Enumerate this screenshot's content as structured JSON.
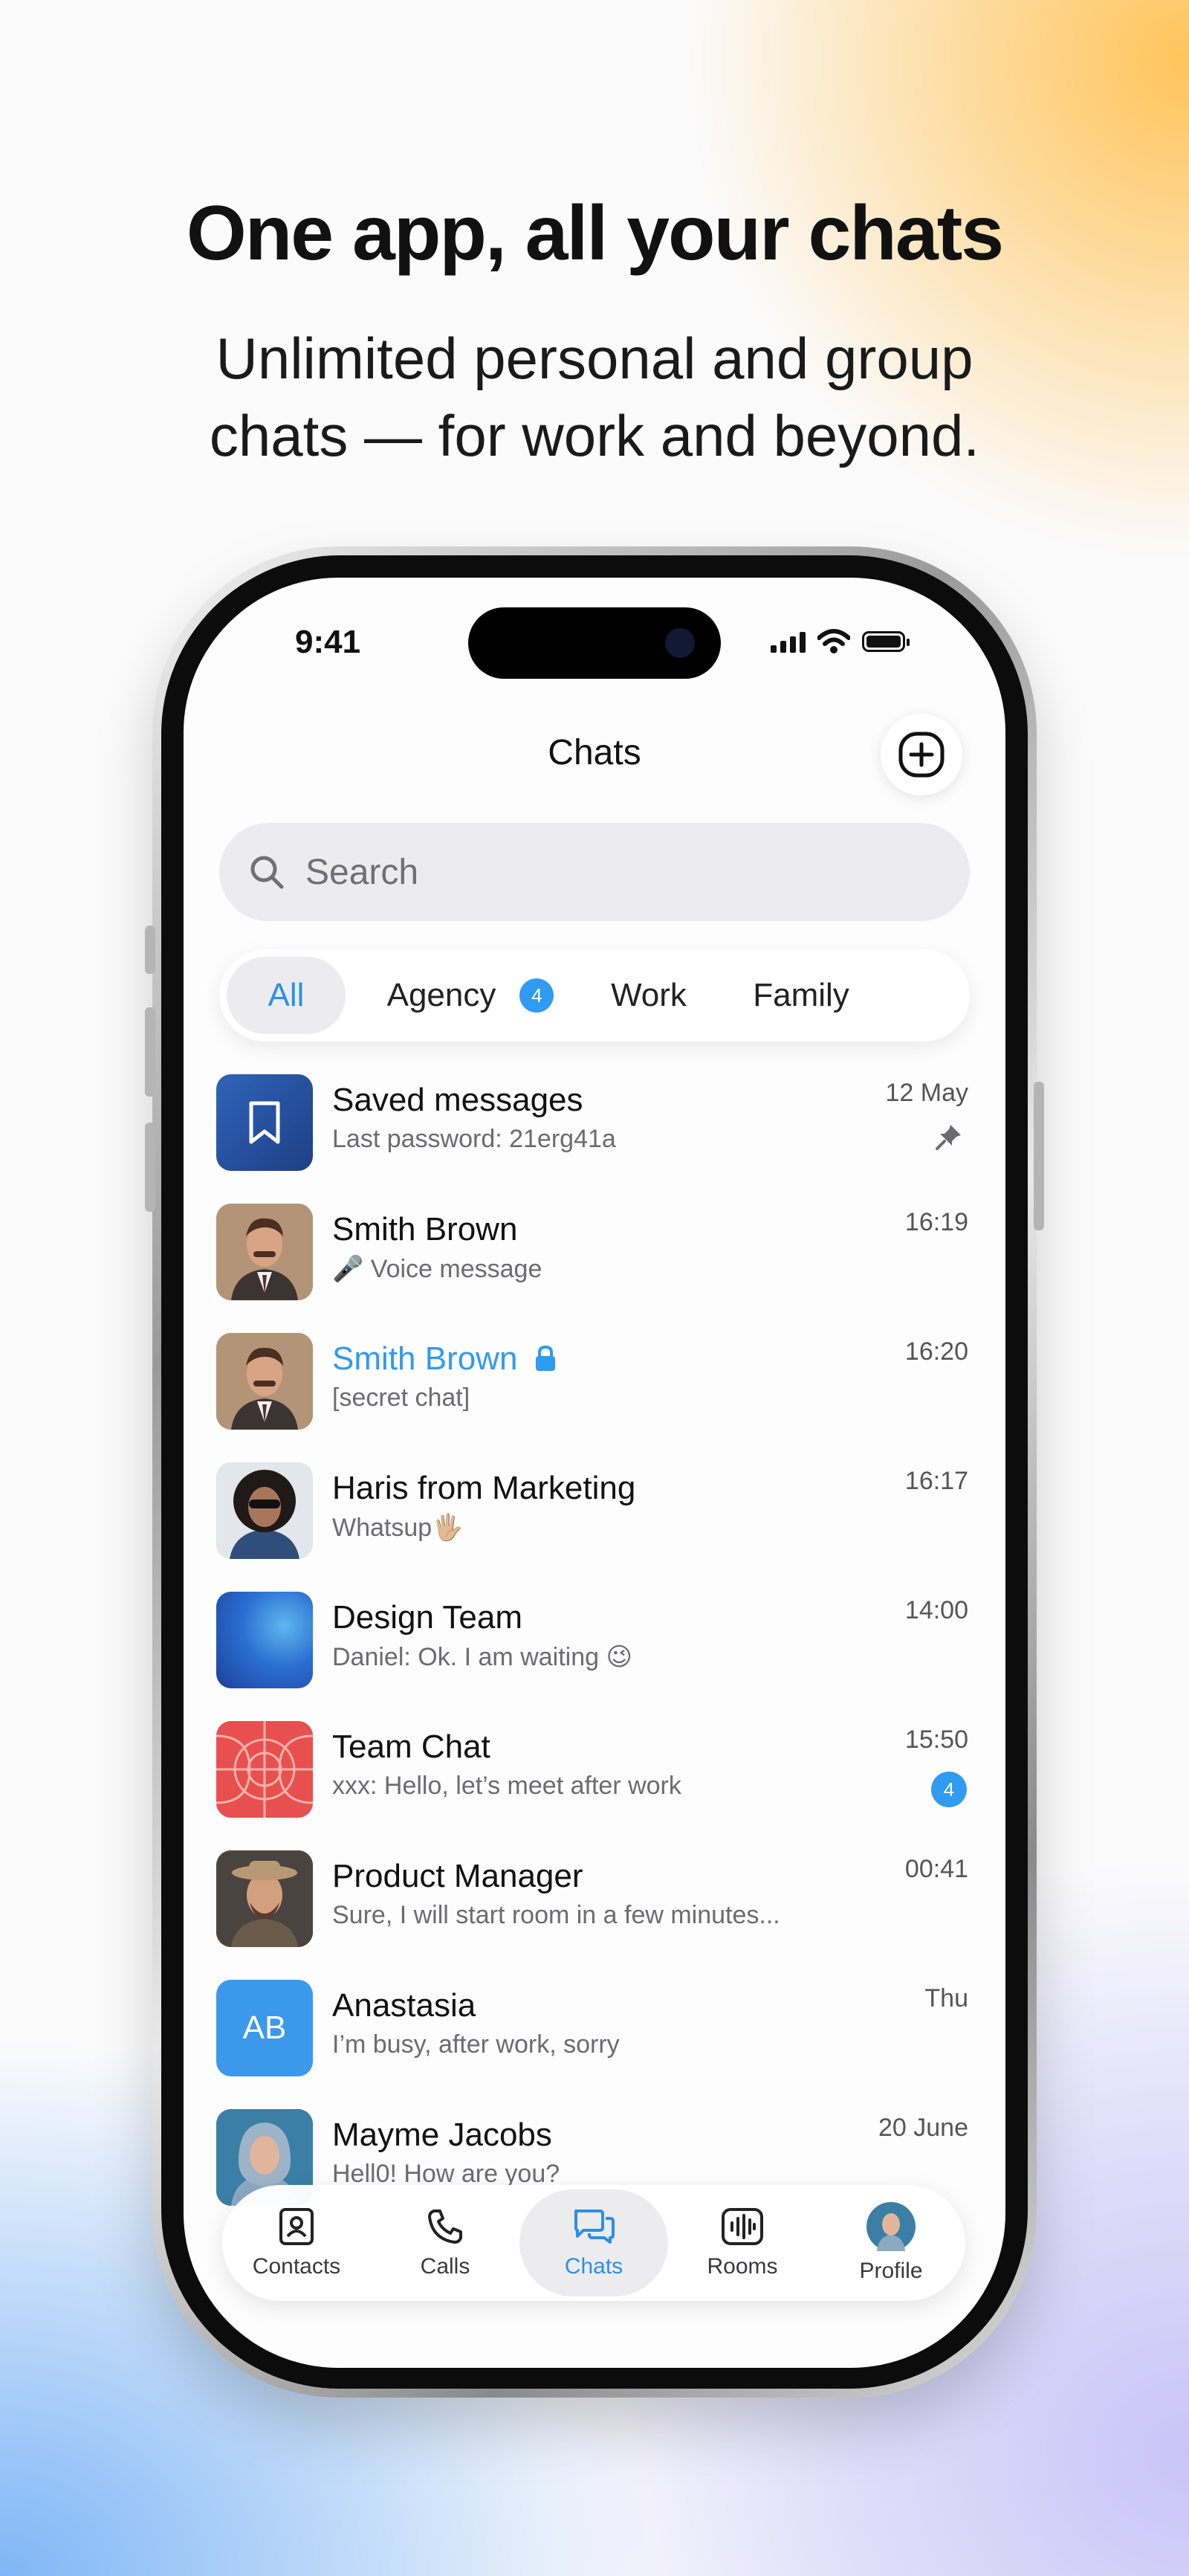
{
  "marketing": {
    "headline": "One app, all your chats",
    "subhead": "Unlimited personal and group chats — for work and beyond."
  },
  "status_bar": {
    "time": "9:41"
  },
  "header": {
    "title": "Chats",
    "compose_icon": "plus-circle-icon"
  },
  "search": {
    "placeholder": "Search"
  },
  "filters": [
    {
      "label": "All",
      "active": true
    },
    {
      "label": "Agency",
      "badge": "4"
    },
    {
      "label": "Work"
    },
    {
      "label": "Family"
    }
  ],
  "chats": [
    {
      "name": "Saved messages",
      "preview": "Last password: 21erg41a",
      "time": "12 May",
      "pinned": true,
      "avatar": "bookmark-icon"
    },
    {
      "name": "Smith Brown",
      "preview": "🎤 Voice message",
      "time": "16:19",
      "avatar": "photo"
    },
    {
      "name": "Smith Brown",
      "preview": "[secret chat]",
      "time": "16:20",
      "secret": true,
      "avatar": "photo"
    },
    {
      "name": "Haris from Marketing",
      "preview": "Whatsup🖐🏼",
      "time": "16:17",
      "avatar": "photo"
    },
    {
      "name": "Design Team",
      "preview": "Daniel: Ok. I am waiting 😉",
      "time": "14:00",
      "avatar": "gradient"
    },
    {
      "name": "Team Chat",
      "preview": "xxx: Hello, let’s meet after work",
      "time": "15:50",
      "unread": "4",
      "avatar": "pattern"
    },
    {
      "name": "Product Manager",
      "preview": "Sure, I will start room in a few minutes...",
      "time": "00:41",
      "avatar": "photo"
    },
    {
      "name": "Anastasia",
      "preview": "I’m busy, after work, sorry",
      "time": "Thu",
      "initials": "AB"
    },
    {
      "name": "Mayme Jacobs",
      "preview": "Hell0! How are you?",
      "time": "20 June",
      "avatar": "photo"
    }
  ],
  "tabbar": [
    {
      "label": "Contacts",
      "icon": "contacts-icon"
    },
    {
      "label": "Calls",
      "icon": "phone-icon"
    },
    {
      "label": "Chats",
      "icon": "chat-bubbles-icon",
      "active": true
    },
    {
      "label": "Rooms",
      "icon": "audio-waves-icon"
    },
    {
      "label": "Profile",
      "icon": "avatar"
    }
  ],
  "colors": {
    "accent": "#2f9bf2",
    "text": "#111111",
    "muted": "#6b6b70"
  }
}
